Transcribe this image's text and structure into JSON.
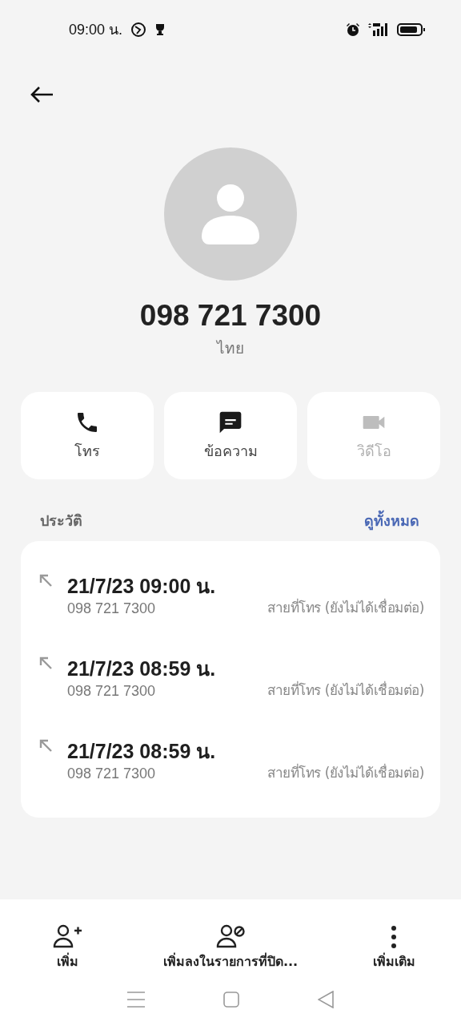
{
  "status_bar": {
    "time": "09:00 น."
  },
  "contact": {
    "number": "098 721 7300",
    "country": "ไทย"
  },
  "actions": [
    {
      "kind": "call",
      "label": "โทร",
      "disabled": false
    },
    {
      "kind": "message",
      "label": "ข้อความ",
      "disabled": false
    },
    {
      "kind": "video",
      "label": "วิดีโอ",
      "disabled": true
    }
  ],
  "history": {
    "title": "ประวัติ",
    "view_all": "ดูทั้งหมด",
    "calls": [
      {
        "datetime": "21/7/23 09:00 น.",
        "number": "098 721 7300",
        "status": "สายที่โทร (ยังไม่ได้เชื่อมต่อ)"
      },
      {
        "datetime": "21/7/23 08:59 น.",
        "number": "098 721 7300",
        "status": "สายที่โทร (ยังไม่ได้เชื่อมต่อ)"
      },
      {
        "datetime": "21/7/23 08:59 น.",
        "number": "098 721 7300",
        "status": "สายที่โทร (ยังไม่ได้เชื่อมต่อ)"
      }
    ]
  },
  "bottom_actions": [
    {
      "kind": "add",
      "label": "เพิ่ม"
    },
    {
      "kind": "block",
      "label": "เพิ่มลงในรายการที่ปิด..."
    },
    {
      "kind": "more",
      "label": "เพิ่มเติม"
    }
  ]
}
